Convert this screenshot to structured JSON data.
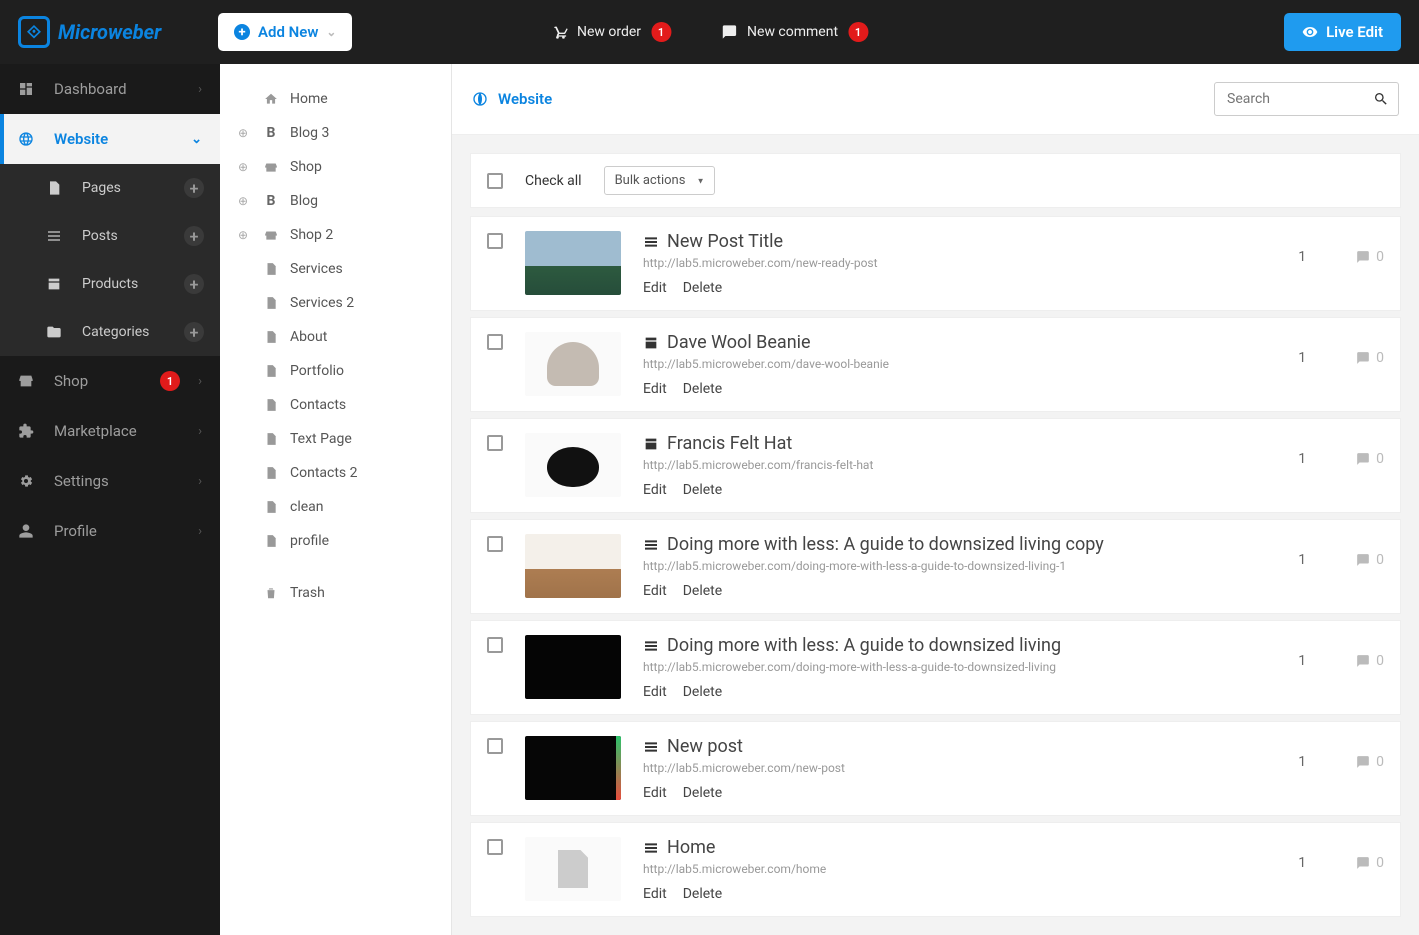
{
  "brand": "Microweber",
  "topbar": {
    "add_new": "Add New",
    "new_order": "New order",
    "new_order_badge": "1",
    "new_comment": "New comment",
    "new_comment_badge": "1",
    "live_edit": "Live Edit"
  },
  "sidebar": {
    "dashboard": "Dashboard",
    "website": "Website",
    "pages": "Pages",
    "posts": "Posts",
    "products": "Products",
    "categories": "Categories",
    "shop": "Shop",
    "shop_badge": "1",
    "marketplace": "Marketplace",
    "settings": "Settings",
    "profile": "Profile"
  },
  "tree": {
    "home": "Home",
    "blog3": "Blog 3",
    "shop": "Shop",
    "blog": "Blog",
    "shop2": "Shop 2",
    "services": "Services",
    "services2": "Services 2",
    "about": "About",
    "portfolio": "Portfolio",
    "contacts": "Contacts",
    "text_page": "Text Page",
    "contacts2": "Contacts 2",
    "clean": "clean",
    "profile": "profile",
    "trash": "Trash"
  },
  "content": {
    "heading": "Website",
    "search_placeholder": "Search",
    "check_all": "Check all",
    "bulk_actions": "Bulk actions",
    "edit": "Edit",
    "delete": "Delete"
  },
  "posts": [
    {
      "title": "New Post Title",
      "url": "http://lab5.microweber.com/new-ready-post",
      "count": "1",
      "comments": "0",
      "type": "post",
      "thumb": "th-landscape"
    },
    {
      "title": "Dave Wool Beanie",
      "url": "http://lab5.microweber.com/dave-wool-beanie",
      "count": "1",
      "comments": "0",
      "type": "product",
      "thumb": "th-beanie"
    },
    {
      "title": "Francis Felt Hat",
      "url": "http://lab5.microweber.com/francis-felt-hat",
      "count": "1",
      "comments": "0",
      "type": "product",
      "thumb": "th-hat"
    },
    {
      "title": "Doing more with less: A guide to downsized living copy",
      "url": "http://lab5.microweber.com/doing-more-with-less-a-guide-to-downsized-living-1",
      "count": "1",
      "comments": "0",
      "type": "post",
      "thumb": "th-desk"
    },
    {
      "title": "Doing more with less: A guide to downsized living",
      "url": "http://lab5.microweber.com/doing-more-with-less-a-guide-to-downsized-living",
      "count": "1",
      "comments": "0",
      "type": "post",
      "thumb": "th-dark"
    },
    {
      "title": "New post",
      "url": "http://lab5.microweber.com/new-post",
      "count": "1",
      "comments": "0",
      "type": "post",
      "thumb": "th-dk2"
    },
    {
      "title": "Home",
      "url": "http://lab5.microweber.com/home",
      "count": "1",
      "comments": "0",
      "type": "post",
      "thumb": "th-file"
    }
  ]
}
